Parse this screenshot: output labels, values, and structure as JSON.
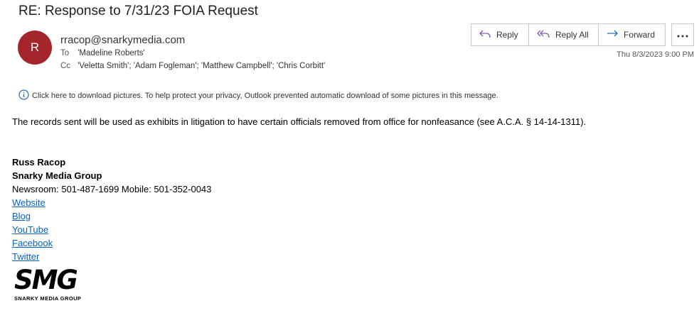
{
  "email": {
    "subject": "RE: Response to 7/31/23 FOIA Request",
    "avatar_initial": "R",
    "avatar_color": "#a4262c",
    "sender": "rracop@snarkymedia.com",
    "to_label": "To",
    "to_value": "'Madeline Roberts'",
    "cc_label": "Cc",
    "cc_value": "'Veletta Smith'; 'Adam Fogleman'; 'Matthew Campbell'; 'Chris Corbitt'",
    "date": "Thu 8/3/2023 9:00 PM"
  },
  "actions": {
    "reply": "Reply",
    "reply_all": "Reply All",
    "forward": "Forward",
    "more_icon": "ellipsis-icon"
  },
  "info_bar": {
    "icon": "info-icon",
    "text": "Click here to download pictures. To help protect your privacy, Outlook prevented automatic download of some pictures in this message."
  },
  "body": {
    "paragraph": "The records sent will be used as exhibits in litigation to have certain officials removed from office for nonfeasance (see A.C.A. § 14-14-1311)."
  },
  "signature": {
    "name": "Russ Racop",
    "company": "Snarky Media Group",
    "phones": "Newsroom: 501-487-1699 Mobile: 501-352-0043",
    "links": [
      "Website",
      "Blog",
      "YouTube",
      "Facebook",
      "Twitter"
    ],
    "link_color": "#0563c1",
    "logo_mark": "SMG",
    "logo_text": "SNARKY MEDIA GROUP"
  }
}
